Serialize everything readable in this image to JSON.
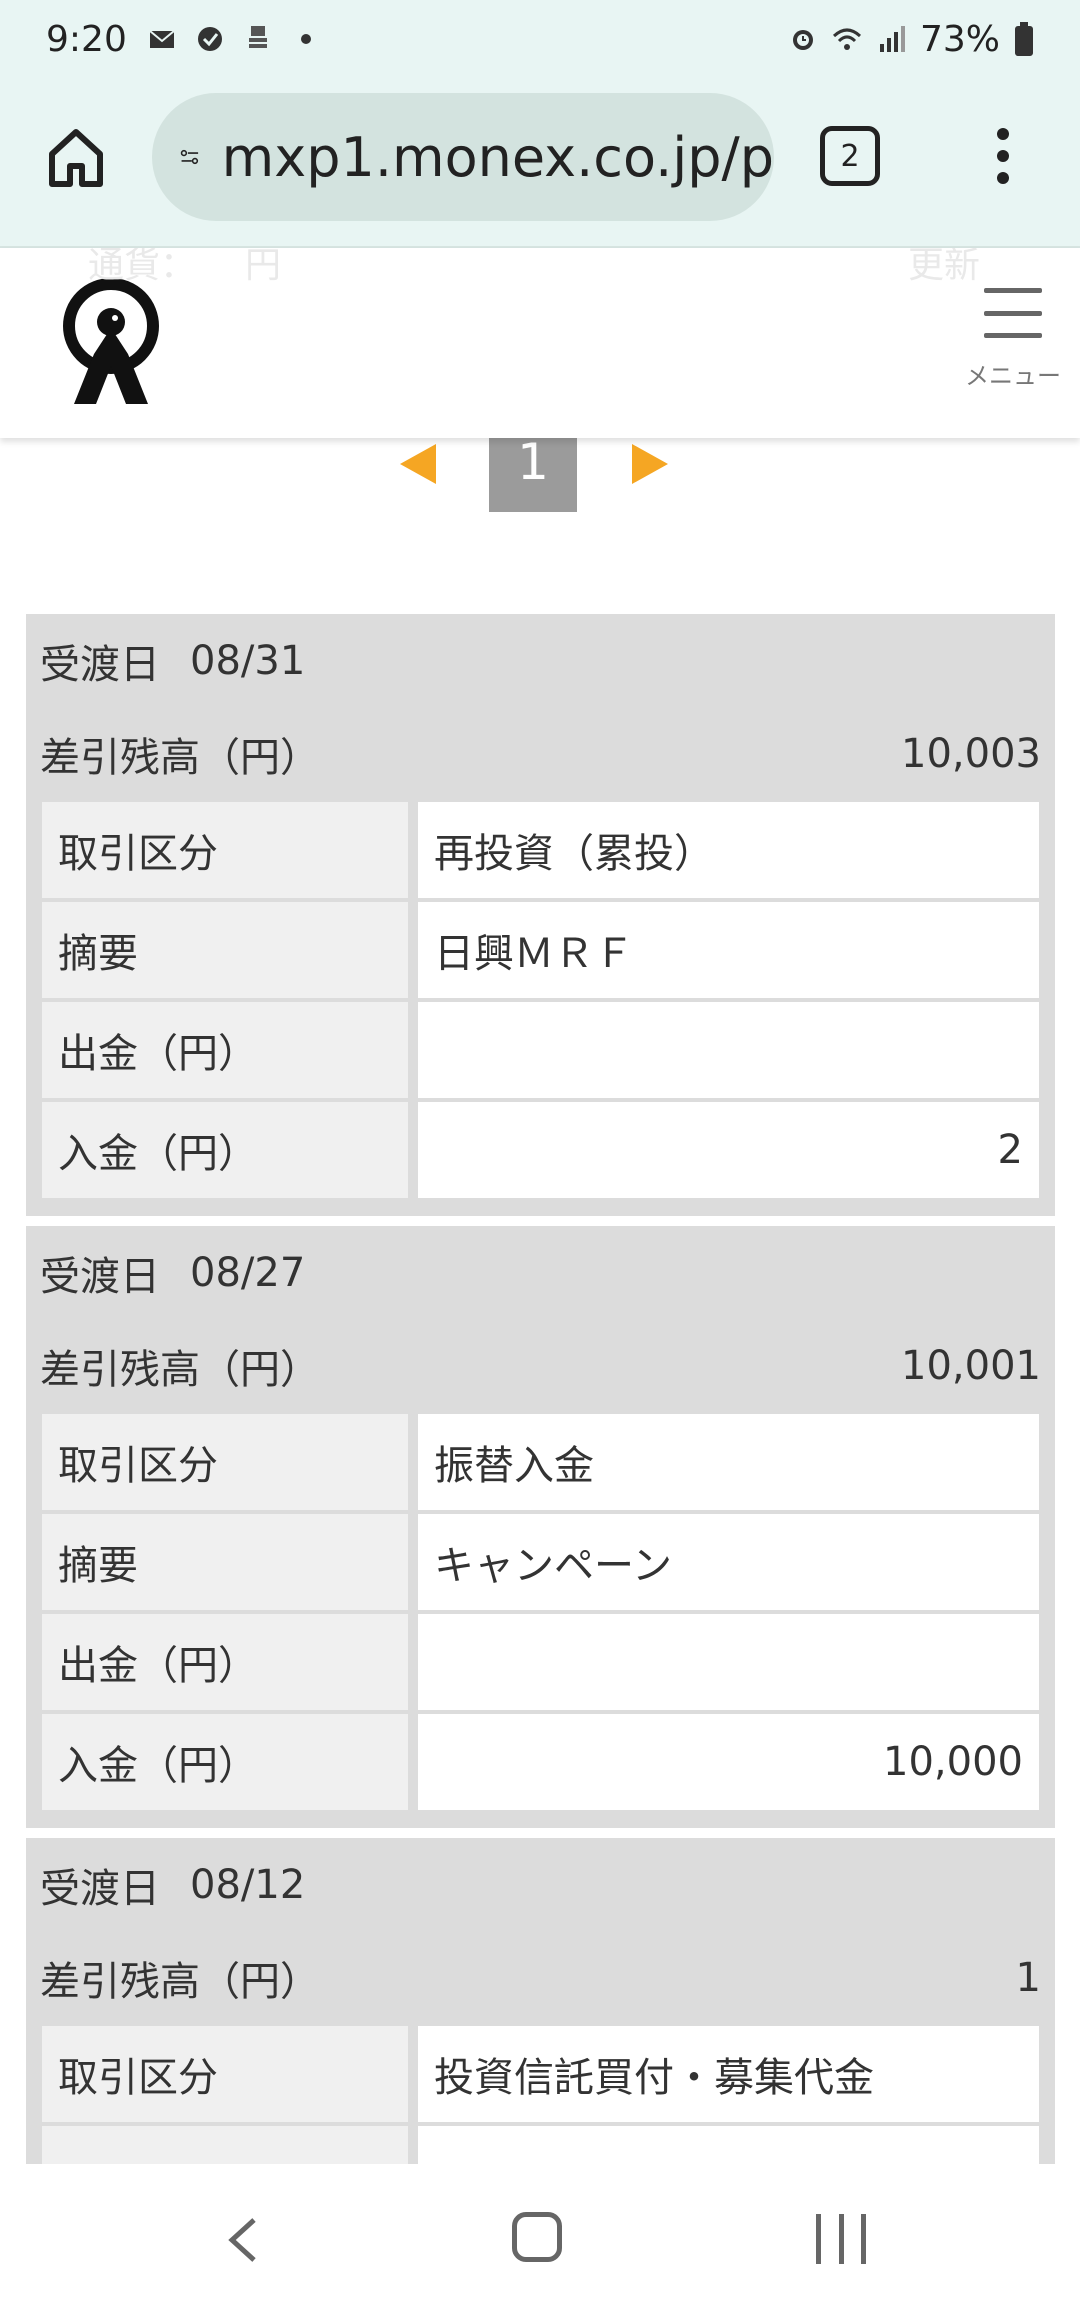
{
  "status_bar": {
    "time": "9:20",
    "battery": "73%"
  },
  "browser": {
    "url": "mxp1.monex.co.jp/p",
    "tab_count": "2"
  },
  "header": {
    "menu_label": "メニュー",
    "ghost_left": "通貨：",
    "ghost_currency": "円",
    "ghost_right": "更新"
  },
  "pager": {
    "current_page": "1"
  },
  "records": [
    {
      "date_label": "受渡日",
      "date": "08/31",
      "balance_label": "差引残高（円）",
      "balance": "10,003",
      "rows": [
        {
          "label": "取引区分",
          "value": "再投資（累投）"
        },
        {
          "label": "摘要",
          "value": "日興ＭＲＦ"
        },
        {
          "label": "出金（円）",
          "value": ""
        },
        {
          "label": "入金（円）",
          "value": "2"
        }
      ]
    },
    {
      "date_label": "受渡日",
      "date": "08/27",
      "balance_label": "差引残高（円）",
      "balance": "10,001",
      "rows": [
        {
          "label": "取引区分",
          "value": "振替入金"
        },
        {
          "label": "摘要",
          "value": "キャンペーン"
        },
        {
          "label": "出金（円）",
          "value": ""
        },
        {
          "label": "入金（円）",
          "value": "10,000"
        }
      ]
    },
    {
      "date_label": "受渡日",
      "date": "08/12",
      "balance_label": "差引残高（円）",
      "balance": "1",
      "rows": [
        {
          "label": "取引区分",
          "value": "投資信託買付・募集代金"
        },
        {
          "label": "摘要",
          "value": ""
        }
      ]
    }
  ]
}
